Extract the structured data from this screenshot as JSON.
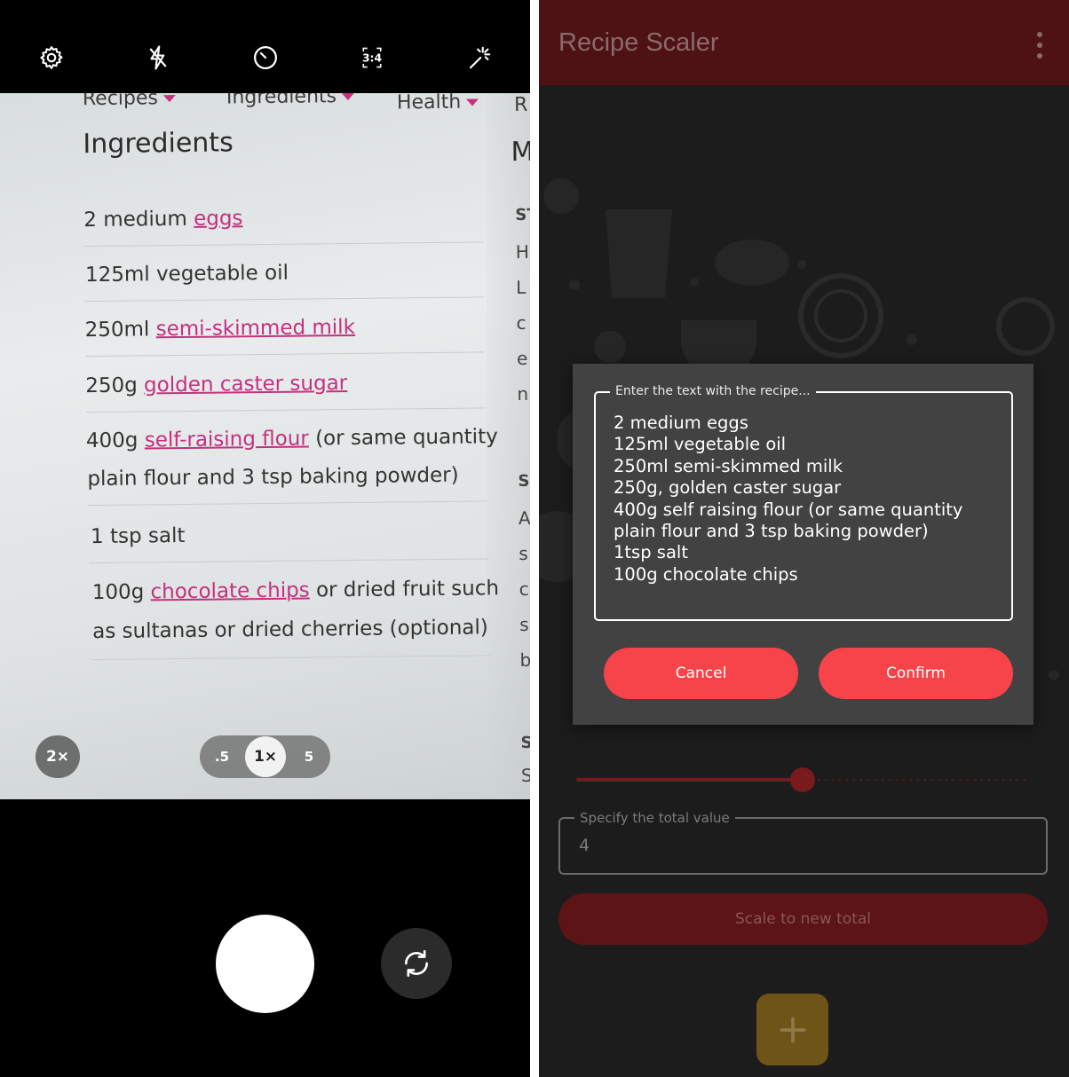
{
  "camera": {
    "toolbar": {
      "settings_icon": "gear-icon",
      "flash_icon": "flash-auto-icon",
      "timer_icon": "timer-icon",
      "ratio_label": "3:4",
      "effects_icon": "magic-wand-icon"
    },
    "photo": {
      "nav_items": [
        "Recipes",
        "Ingredients",
        "Health"
      ],
      "nav_partial": "R",
      "heading": "Ingredients",
      "heading_partial": "M",
      "lines": [
        {
          "pre": "2 medium ",
          "link": "eggs",
          "post": ""
        },
        {
          "pre": "125ml vegetable oil",
          "link": "",
          "post": ""
        },
        {
          "pre": "250ml ",
          "link": "semi-skimmed milk",
          "post": ""
        },
        {
          "pre": "250g ",
          "link": "golden caster sugar",
          "post": ""
        },
        {
          "pre": "400g ",
          "link": "self-raising flour",
          "post": " (or same quantity"
        },
        {
          "pre": "plain flour and 3 tsp baking powder)",
          "link": "",
          "post": ""
        },
        {
          "pre": "1 tsp salt",
          "link": "",
          "post": ""
        },
        {
          "pre": "100g ",
          "link": "chocolate chips",
          "post": " or dried fruit such"
        },
        {
          "pre": "as sultanas or dried cherries (optional)",
          "link": "",
          "post": ""
        }
      ],
      "side_letters": [
        "ST",
        "H",
        "L",
        "c",
        "e",
        "n",
        "S",
        "A",
        "s",
        "c",
        "s",
        "b",
        "S",
        "S"
      ]
    },
    "zoom": {
      "preset": "2×",
      "options": [
        ".5",
        "1×",
        "5"
      ],
      "selected": "1×"
    },
    "shutter_icon": "shutter-button",
    "switch_icon": "switch-camera-icon"
  },
  "app": {
    "title": "Recipe Scaler",
    "menu_icon": "more-vert-icon",
    "dialog": {
      "field_label": "Enter the text with the recipe...",
      "recipe_text": "2 medium eggs\n125ml vegetable oil\n250ml semi-skimmed milk\n250g, golden caster sugar\n400g self raising flour (or same quantity\nplain flour and 3 tsp baking powder)\n1tsp salt\n100g chocolate chips",
      "cancel_label": "Cancel",
      "confirm_label": "Confirm"
    },
    "slider": {
      "value_fraction": 0.5
    },
    "total_field": {
      "label": "Specify the total value",
      "value": "4"
    },
    "scale_button": "Scale to new total",
    "fab_icon": "plus-icon",
    "colors": {
      "appbar": "#4e1214",
      "button": "#f7434a",
      "dialog": "#424242",
      "fab": "#6f5417"
    }
  }
}
